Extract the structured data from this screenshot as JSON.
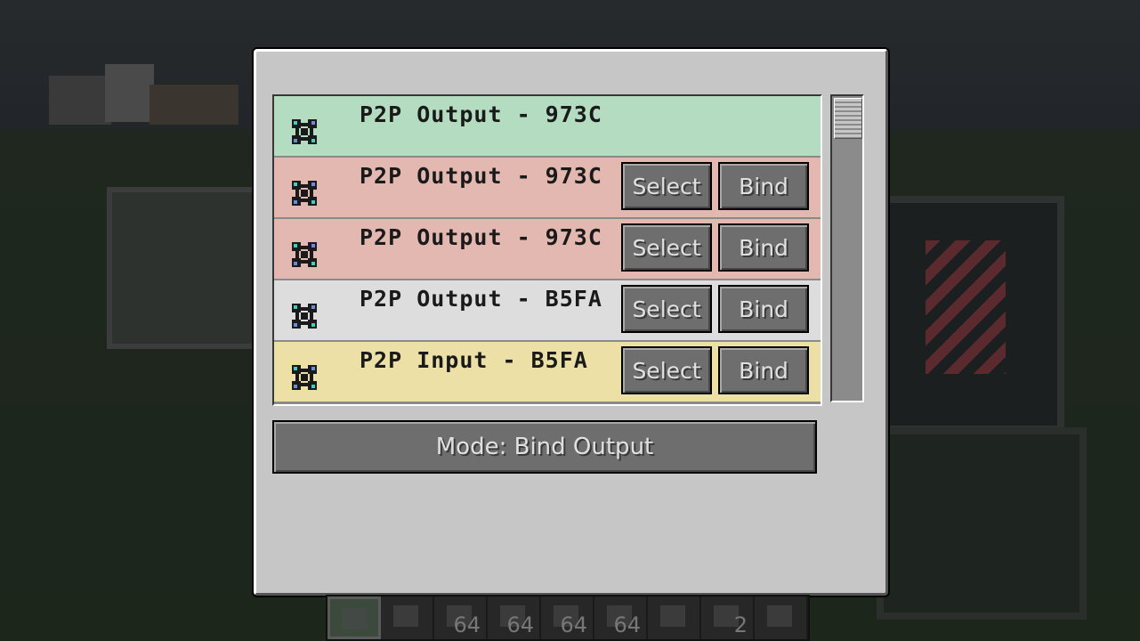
{
  "gui": {
    "rows": [
      {
        "label": "P2P Output - 973C",
        "color": "#b3dcc0",
        "has_buttons": false
      },
      {
        "label": "P2P Output - 973C",
        "color": "#e2b8b0",
        "has_buttons": true
      },
      {
        "label": "P2P Output - 973C",
        "color": "#e2b8b0",
        "has_buttons": true
      },
      {
        "label": "P2P Output - B5FA",
        "color": "#dddddd",
        "has_buttons": true
      },
      {
        "label": "P2P Input - B5FA",
        "color": "#ece0a6",
        "has_buttons": true
      }
    ],
    "select_label": "Select",
    "bind_label": "Bind",
    "mode_label": "Mode: Bind Output"
  },
  "hotbar": {
    "slots": [
      {
        "icon": "terminal-icon",
        "count": ""
      },
      {
        "icon": "terminal-icon",
        "count": ""
      },
      {
        "icon": "block-icon",
        "count": "64"
      },
      {
        "icon": "block-icon",
        "count": "64"
      },
      {
        "icon": "block-icon",
        "count": "64"
      },
      {
        "icon": "block-icon",
        "count": "64"
      },
      {
        "icon": "wrench-icon",
        "count": ""
      },
      {
        "icon": "block-icon",
        "count": "2"
      },
      {
        "icon": "frame-icon",
        "count": ""
      }
    ]
  }
}
